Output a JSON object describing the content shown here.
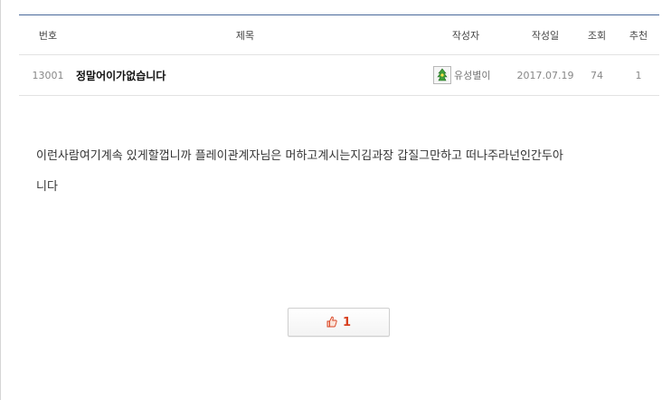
{
  "table_header": {
    "no": "번호",
    "title": "제목",
    "author": "작성자",
    "date": "작성일",
    "views": "조회",
    "recommend": "추천"
  },
  "post": {
    "no": "13001",
    "title": "정말어이가없습니다",
    "author": "유성별이",
    "author_icon": "level-badge-icon",
    "date": "2017.07.19",
    "views": "74",
    "recommend": "1"
  },
  "content": {
    "line1": "이런사람여기계속 있게할껍니까 플레이관계자님은 머하고계시는지김과장 갑질그만하고 떠나주라넌인간두아",
    "line2": "니다"
  },
  "recommend_button": {
    "icon": "thumbs-up-icon",
    "count": "1"
  },
  "colors": {
    "header_border": "#4a6a9a",
    "recommend_count": "#d8401f"
  }
}
